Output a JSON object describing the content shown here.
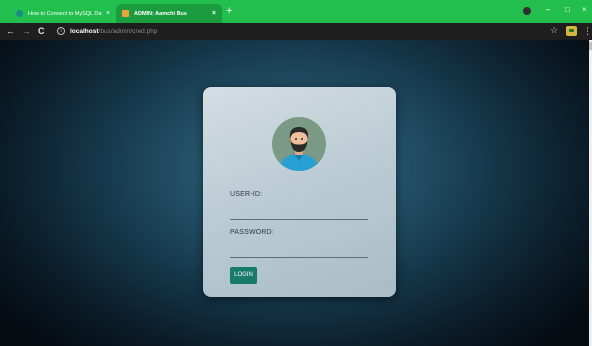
{
  "browser": {
    "tabs": [
      {
        "title": "How to Connect to MySQL Data...",
        "active": false
      },
      {
        "title": "ADMIN: Aamchi Bus",
        "active": true
      }
    ],
    "tab_close": "×",
    "new_tab": "+",
    "url_host": "localhost",
    "url_path": "/bus/admin/cred.php",
    "icons": {
      "back": "←",
      "forward": "→",
      "reload": "C",
      "info": "i",
      "star": "☆",
      "menu": "⋮",
      "minimize": "–",
      "maximize": "□",
      "close": "×"
    },
    "colors": {
      "tabstrip": "#22bf4e",
      "toolbar": "#1e1e1e"
    }
  },
  "login": {
    "user_label": "USER-ID:",
    "user_value": "",
    "password_label": "PASSWORD:",
    "password_value": "",
    "button_label": "LOGIN",
    "colors": {
      "button": "#177a6b",
      "avatar_bg": "#7a9a86",
      "shirt": "#29a0d4"
    }
  }
}
